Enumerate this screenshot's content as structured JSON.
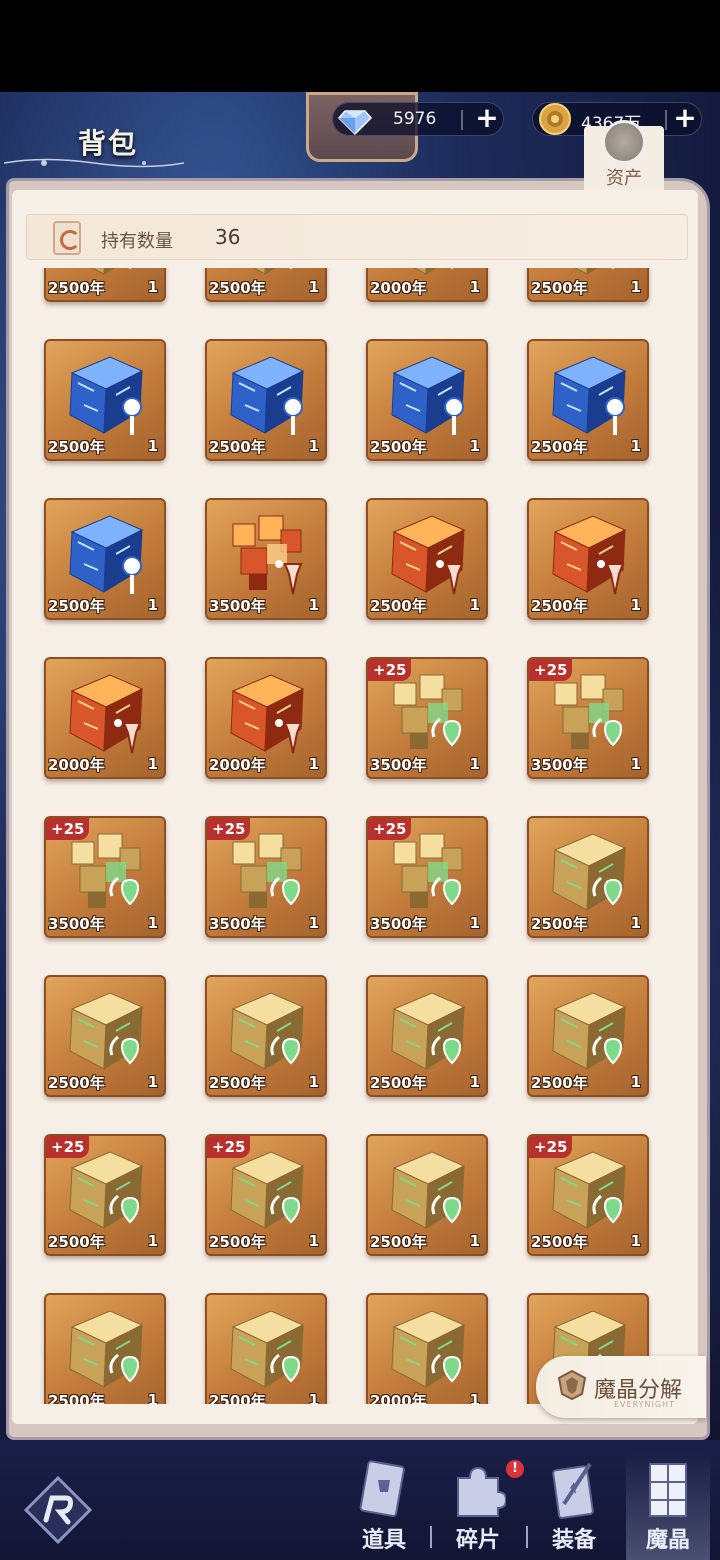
{
  "header": {
    "title": "背包"
  },
  "resources": {
    "gems": {
      "value": "5976",
      "plus": "+"
    },
    "coins": {
      "value": "4367万",
      "plus": "+"
    }
  },
  "asset_button": {
    "label": "资产"
  },
  "count_bar": {
    "label": "持有数量",
    "value": "36"
  },
  "colors": {
    "blue": "#3d7ad9",
    "red": "#d9562a",
    "gold": "#d9b866",
    "badge": "#b8312c"
  },
  "items": [
    {
      "type": "gold-cube",
      "level": "2500年",
      "qty": "1",
      "badge": ""
    },
    {
      "type": "gold-cube",
      "level": "2500年",
      "qty": "1",
      "badge": ""
    },
    {
      "type": "gold-cube",
      "level": "2000年",
      "qty": "1",
      "badge": ""
    },
    {
      "type": "gold-cube",
      "level": "2500年",
      "qty": "1",
      "badge": ""
    },
    {
      "type": "blue-cube",
      "level": "2500年",
      "qty": "1",
      "badge": ""
    },
    {
      "type": "blue-cube",
      "level": "2500年",
      "qty": "1",
      "badge": ""
    },
    {
      "type": "blue-cube",
      "level": "2500年",
      "qty": "1",
      "badge": ""
    },
    {
      "type": "blue-cube",
      "level": "2500年",
      "qty": "1",
      "badge": ""
    },
    {
      "type": "blue-cube",
      "level": "2500年",
      "qty": "1",
      "badge": ""
    },
    {
      "type": "red-fragment",
      "level": "3500年",
      "qty": "1",
      "badge": ""
    },
    {
      "type": "red-cube",
      "level": "2500年",
      "qty": "1",
      "badge": ""
    },
    {
      "type": "red-cube",
      "level": "2500年",
      "qty": "1",
      "badge": ""
    },
    {
      "type": "red-cube",
      "level": "2000年",
      "qty": "1",
      "badge": ""
    },
    {
      "type": "red-cube",
      "level": "2000年",
      "qty": "1",
      "badge": ""
    },
    {
      "type": "gold-fragment",
      "level": "3500年",
      "qty": "1",
      "badge": "+25"
    },
    {
      "type": "gold-fragment",
      "level": "3500年",
      "qty": "1",
      "badge": "+25"
    },
    {
      "type": "gold-fragment",
      "level": "3500年",
      "qty": "1",
      "badge": "+25"
    },
    {
      "type": "gold-fragment",
      "level": "3500年",
      "qty": "1",
      "badge": "+25"
    },
    {
      "type": "gold-fragment",
      "level": "3500年",
      "qty": "1",
      "badge": "+25"
    },
    {
      "type": "gold-cube",
      "level": "2500年",
      "qty": "1",
      "badge": ""
    },
    {
      "type": "gold-cube",
      "level": "2500年",
      "qty": "1",
      "badge": ""
    },
    {
      "type": "gold-cube",
      "level": "2500年",
      "qty": "1",
      "badge": ""
    },
    {
      "type": "gold-cube",
      "level": "2500年",
      "qty": "1",
      "badge": ""
    },
    {
      "type": "gold-cube",
      "level": "2500年",
      "qty": "1",
      "badge": ""
    },
    {
      "type": "gold-cube",
      "level": "2500年",
      "qty": "1",
      "badge": "+25"
    },
    {
      "type": "gold-cube",
      "level": "2500年",
      "qty": "1",
      "badge": "+25"
    },
    {
      "type": "gold-cube",
      "level": "2500年",
      "qty": "1",
      "badge": ""
    },
    {
      "type": "gold-cube",
      "level": "2500年",
      "qty": "1",
      "badge": "+25"
    },
    {
      "type": "gold-cube",
      "level": "2500年",
      "qty": "1",
      "badge": ""
    },
    {
      "type": "gold-cube",
      "level": "2500年",
      "qty": "1",
      "badge": ""
    },
    {
      "type": "gold-cube",
      "level": "2000年",
      "qty": "1",
      "badge": ""
    },
    {
      "type": "gold-cube",
      "level": "",
      "qty": "",
      "badge": ""
    }
  ],
  "decompose_button": {
    "label": "魔晶分解",
    "sub": "EVERYNIGHT"
  },
  "nav": {
    "items": [
      {
        "label": "道具",
        "icon": "potion-card-icon"
      },
      {
        "label": "碎片",
        "icon": "puzzle-icon",
        "alert": "!"
      },
      {
        "label": "装备",
        "icon": "sword-card-icon"
      },
      {
        "label": "魔晶",
        "icon": "cube-stack-icon",
        "active": true
      }
    ]
  }
}
